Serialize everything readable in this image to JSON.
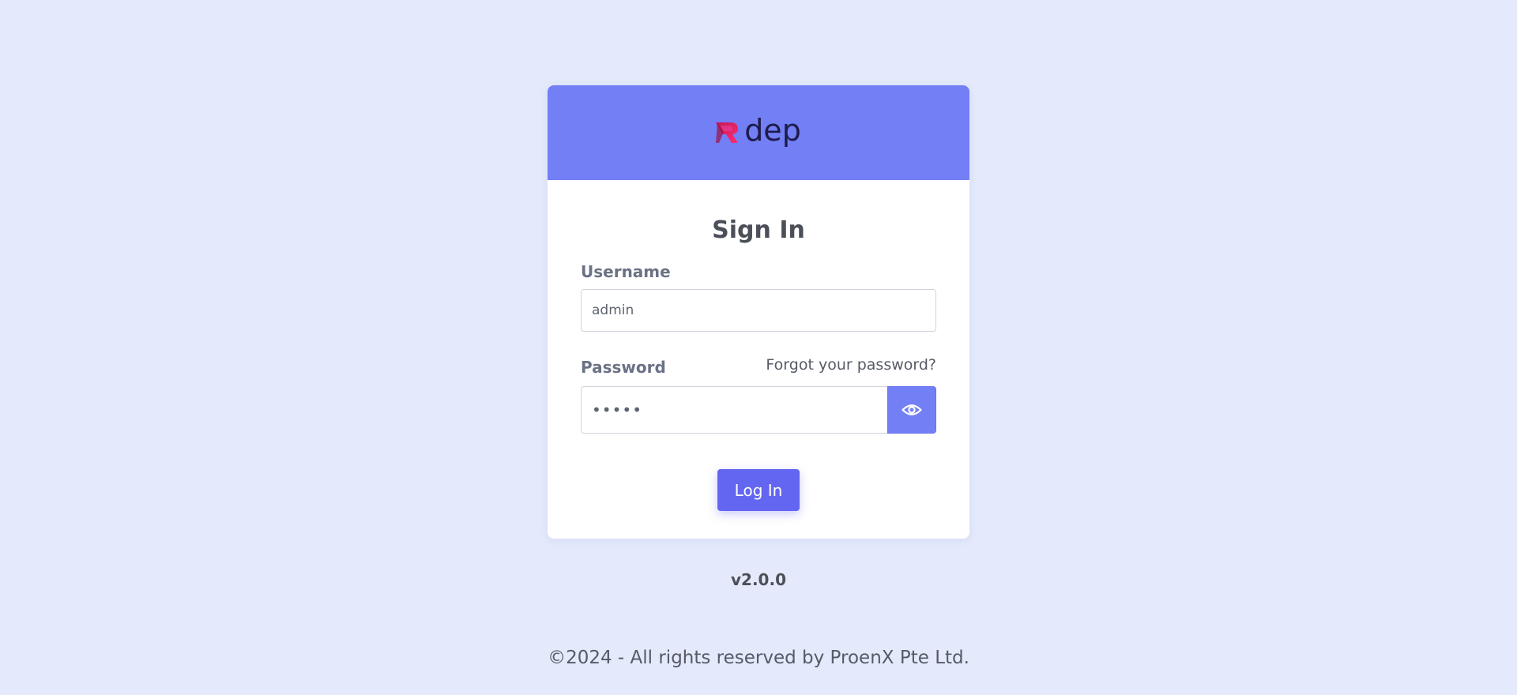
{
  "brand": {
    "logo_text": "dep",
    "header_color": "#727ff5",
    "accent_color": "#6366f1"
  },
  "form": {
    "title": "Sign In",
    "username_label": "Username",
    "username_value": "admin",
    "password_label": "Password",
    "password_value": "admin",
    "forgot_link": "Forgot your password?",
    "toggle_visibility_icon": "eye-icon",
    "submit_label": "Log In"
  },
  "version": "v2.0.0",
  "footer": {
    "copyright": "©2024 - All rights reserved by ProenX Pte Ltd."
  }
}
